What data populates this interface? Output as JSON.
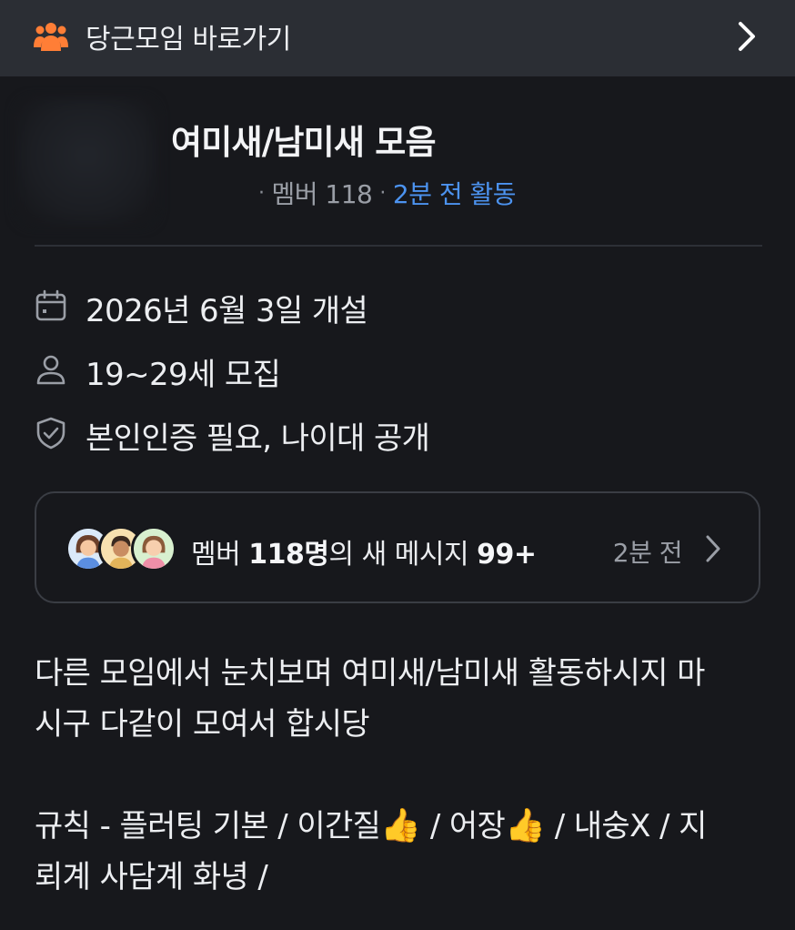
{
  "topbar": {
    "title": "당근모임 바로가기",
    "logo_icon": "group-people-icon",
    "chevron_icon": "chevron-right-icon",
    "accent": "#ff7e36"
  },
  "group": {
    "title": "여미새/남미새 모음",
    "dot1": "·",
    "members": "멤버 118",
    "dot2": "·",
    "last_active": "2분 전 활동",
    "active_color": "#4c93f0"
  },
  "info": {
    "founded": "2026년 6월 3일 개설",
    "age": "19~29세 모집",
    "requirements": "본인인증 필요, 나이대 공개"
  },
  "chat": {
    "prefix": "멤버 ",
    "count": "118명",
    "middle": "의 새 메시지 ",
    "unread": "99+",
    "time": "2분 전"
  },
  "description": {
    "line1": "다른 모임에서 눈치보며 여미새/남미새 활동하시지 마",
    "line2": "시구 다같이 모여서 합시당",
    "rules_1": "규칙 - 플러팅 기본 / 이간질",
    "emoji_1": "👍",
    "rules_2": " / 어장",
    "emoji_2": "👍",
    "rules_3": " / 내숭X / 지",
    "line4": "뢰계 사담계 화녕 /"
  }
}
